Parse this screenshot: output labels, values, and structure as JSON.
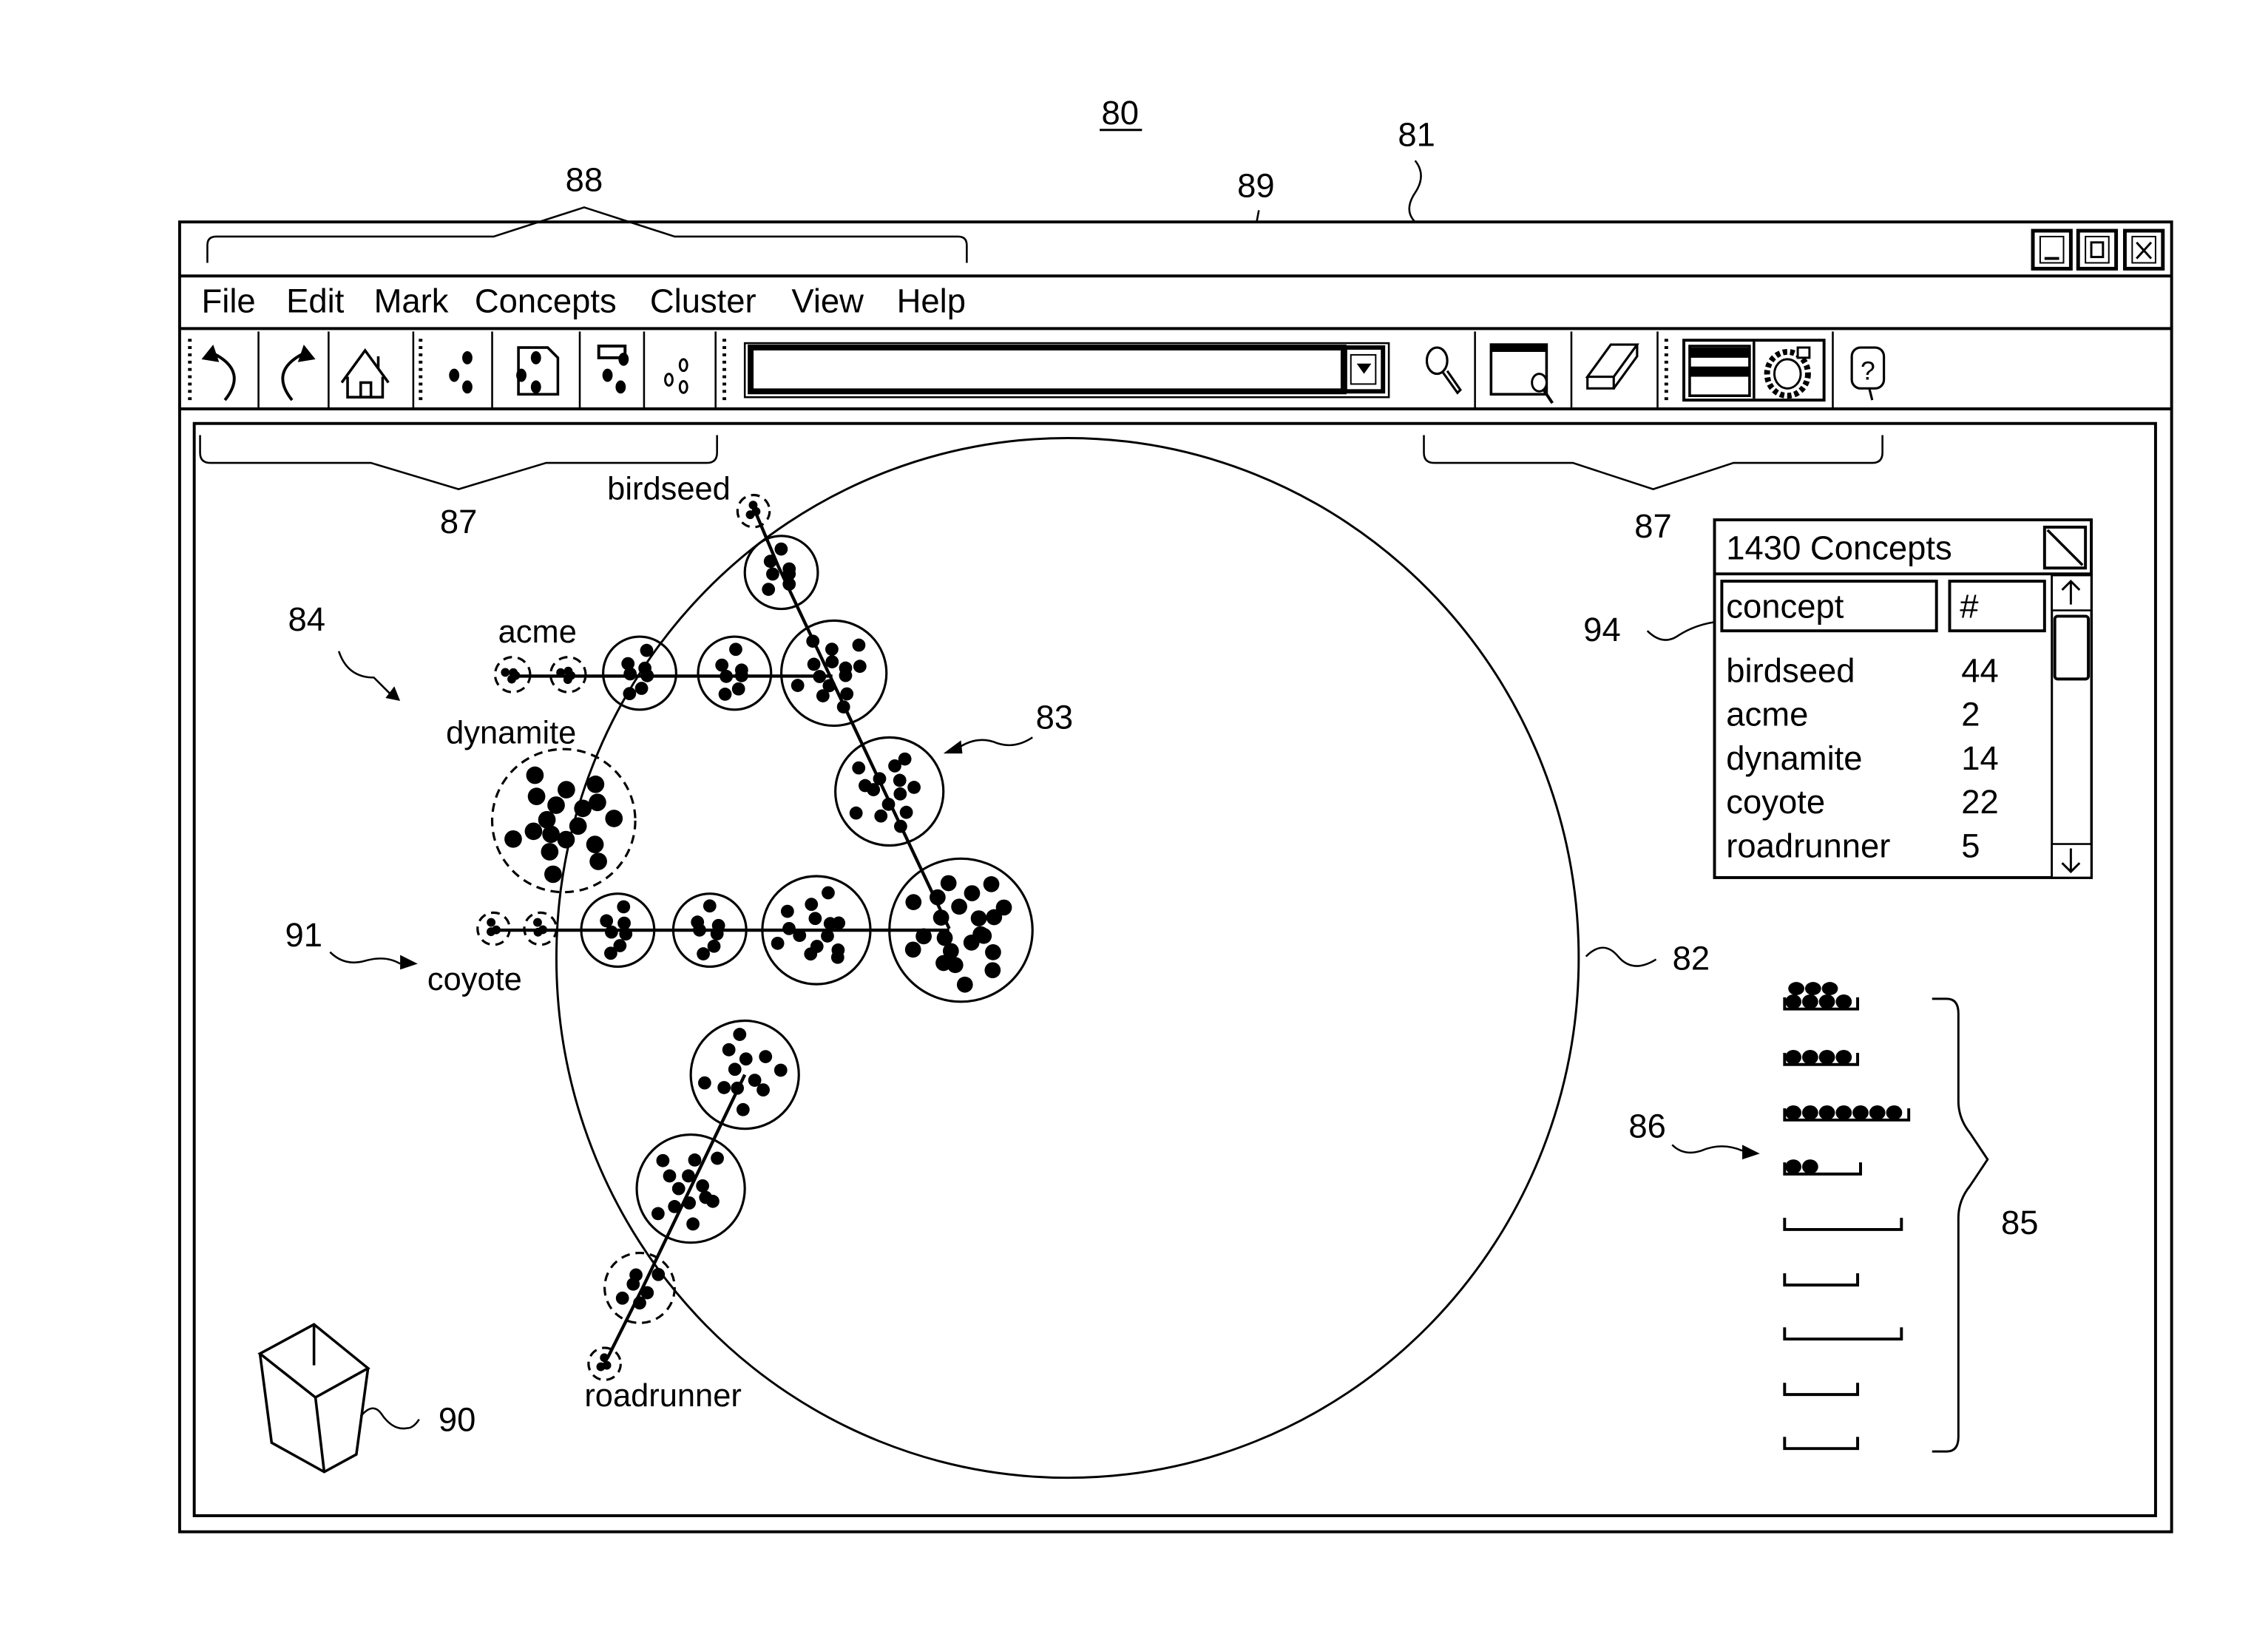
{
  "figure": {
    "figure_number": "80",
    "reference_numerals": {
      "window": "81",
      "display_circle": "82",
      "spine": "83",
      "clusters": "84",
      "bins": "85",
      "bin_arrow": "86",
      "toolbar_groups_left": "87",
      "toolbar_groups_right": "87",
      "menu_bracket": "88",
      "search_box": "89",
      "garbage_can": "90",
      "cluster_spine_arrow": "91",
      "concepts_list": "94"
    }
  },
  "window": {
    "controls": [
      {
        "name": "minimize",
        "glyph": "_"
      },
      {
        "name": "maximize",
        "glyph": "□"
      },
      {
        "name": "close",
        "glyph": "X"
      }
    ]
  },
  "menu": {
    "items": [
      "File",
      "Edit",
      "Mark",
      "Concepts",
      "Cluster",
      "View",
      "Help"
    ]
  },
  "toolbar": {
    "left_buttons": [
      "undo-icon",
      "redo-icon",
      "home-icon",
      "cluster-points-icon",
      "document-points-icon",
      "select-cluster-icon",
      "unselected-cluster-icon"
    ],
    "search": {
      "value": "",
      "placeholder": ""
    },
    "right_buttons": [
      "search-icon",
      "window-search-icon",
      "eraser-icon",
      "list-view-icon",
      "circle-view-icon",
      "help-icon"
    ]
  },
  "display": {
    "spine_labels": [
      "birdseed",
      "acme",
      "dynamite",
      "coyote",
      "roadrunner"
    ]
  },
  "concepts_panel": {
    "title": "1430 Concepts",
    "columns": [
      "concept",
      "#"
    ],
    "rows": [
      {
        "concept": "birdseed",
        "count": "44"
      },
      {
        "concept": "acme",
        "count": "2"
      },
      {
        "concept": "dynamite",
        "count": "14"
      },
      {
        "concept": "coyote",
        "count": "22"
      },
      {
        "concept": "roadrunner",
        "count": "5"
      }
    ]
  },
  "bins": {
    "counts": [
      7,
      4,
      7,
      2,
      0,
      0,
      0,
      0,
      0
    ]
  }
}
